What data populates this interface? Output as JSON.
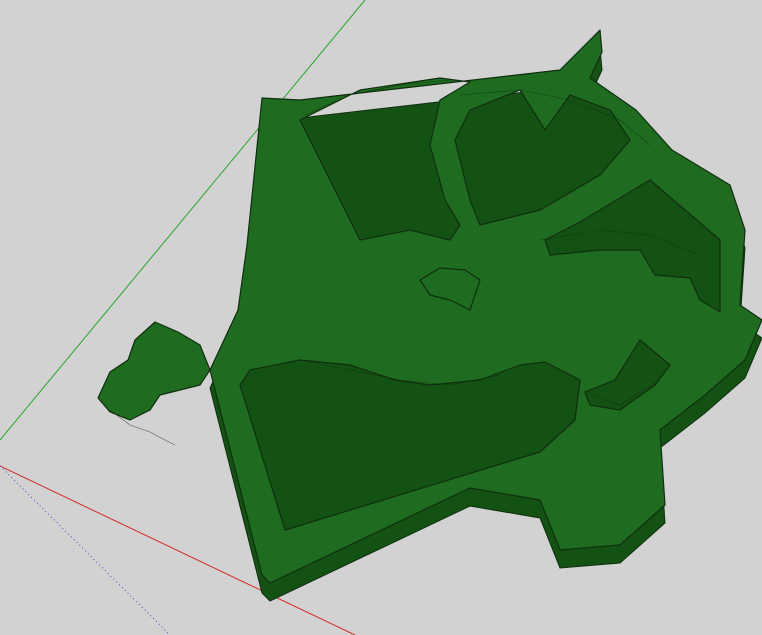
{
  "viewport": {
    "background": "#d2d2d2",
    "model": {
      "name": "3d-printed-ornament",
      "fill_color": "#1f6b1f",
      "side_color": "#145214",
      "edge_color": "#0f2f0f"
    },
    "axes": [
      {
        "name": "green-axis",
        "color": "#2aa52a",
        "style": "solid"
      },
      {
        "name": "red-axis",
        "color": "#d32b2b",
        "style": "solid"
      },
      {
        "name": "blue-axis",
        "color": "#3b4bcc",
        "style": "dotted"
      }
    ]
  }
}
